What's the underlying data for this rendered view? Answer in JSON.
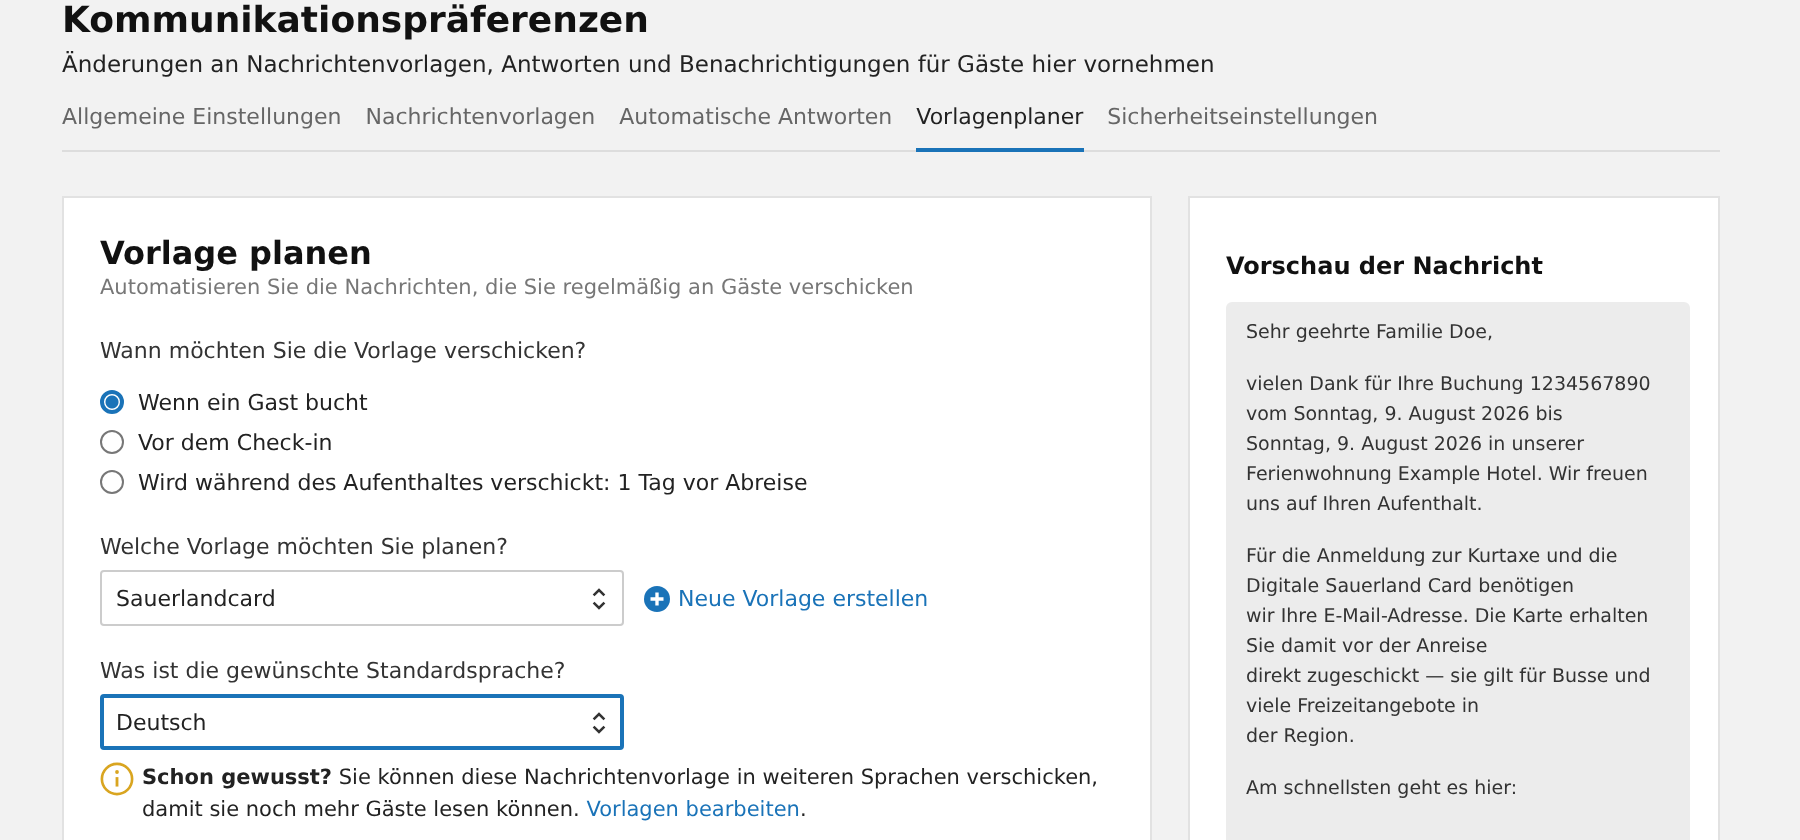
{
  "page": {
    "title": "Kommunikationspräferenzen",
    "subtitle": "Änderungen an Nachrichtenvorlagen, Antworten und Benachrichtigungen für Gäste hier vornehmen"
  },
  "tabs": [
    {
      "label": "Allgemeine Einstellungen",
      "selected": false
    },
    {
      "label": "Nachrichtenvorlagen",
      "selected": false
    },
    {
      "label": "Automatische Antworten",
      "selected": false
    },
    {
      "label": "Vorlagenplaner",
      "selected": true
    },
    {
      "label": "Sicherheitseinstellungen",
      "selected": false
    }
  ],
  "form": {
    "title": "Vorlage planen",
    "subtitle": "Automatisieren Sie die Nachrichten, die Sie regelmäßig an Gäste verschicken",
    "when_label": "Wann möchten Sie die Vorlage verschicken?",
    "options": [
      {
        "label": "Wenn ein Gast bucht",
        "selected": true
      },
      {
        "label": "Vor dem Check-in",
        "selected": false
      },
      {
        "label": "Wird während des Aufenthaltes verschickt: 1 Tag vor Abreise",
        "selected": false
      }
    ],
    "template_label": "Welche Vorlage möchten Sie planen?",
    "template_value": "Sauerlandcard",
    "template_focused": false,
    "new_template_link": "Neue Vorlage erstellen",
    "language_label": "Was ist die gewünschte Standardsprache?",
    "language_value": "Deutsch",
    "language_focused": true,
    "tip": {
      "text": "**Schon gewusst?** Sie können diese Nachrichtenvorlage in weiteren Sprachen verschicken, damit sie noch mehr Gäste lesen können. ",
      "link": "Vorlagen bearbeiten",
      "after": "."
    }
  },
  "preview": {
    "title": "Vorschau der Nachricht",
    "paragraphs": [
      [
        "Sehr geehrte Familie Doe,"
      ],
      [
        "vielen Dank für Ihre Buchung 1234567890",
        "vom Sonntag, 9. August 2026 bis",
        "Sonntag, 9. August 2026 in unserer",
        "Ferienwohnung Example Hotel. Wir freuen",
        "uns auf Ihren Aufenthalt."
      ],
      [
        "Für die Anmeldung zur Kurtaxe und die",
        "Digitale Sauerland Card benötigen",
        "wir Ihre E-Mail-Adresse. Die Karte erhalten",
        "Sie damit vor der Anreise",
        "direkt zugeschickt — sie gilt für Busse und",
        "viele Freizeitangebote in",
        "der Region."
      ],
      [
        "Am schnellsten geht es hier:"
      ]
    ]
  }
}
